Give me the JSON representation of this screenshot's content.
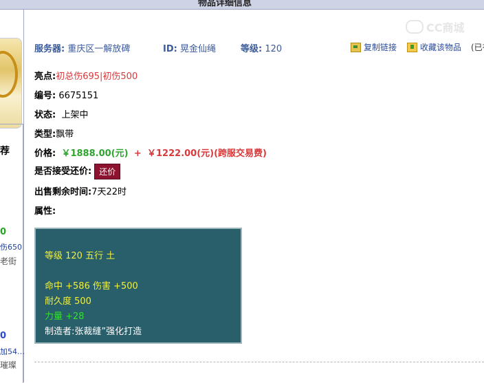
{
  "header": {
    "title": "物品详细信息"
  },
  "watermark": {
    "text": "CC商城"
  },
  "sidebar": {
    "heading": "荐",
    "items": [
      {
        "price": "0",
        "name": "伤650",
        "seller": "老街"
      },
      {
        "price": "0",
        "name": "加54…",
        "seller": "璀璨"
      }
    ]
  },
  "info": {
    "server_label": "服务器:",
    "server_value": "重庆区一解放碑",
    "id_label": "ID:",
    "id_value": "晃金仙绳",
    "level_label": "等级:",
    "level_value": "120",
    "copy_link": "复制链接",
    "favorite": "收藏该物品",
    "extra": "(已有"
  },
  "details": {
    "highlight_label": "亮点:",
    "highlight_value": "初总伤695|初伤500",
    "number_label": "编号:",
    "number_value": "6675151",
    "status_label": "状态:",
    "status_value": "上架中",
    "type_label": "类型:",
    "type_value": "飘带",
    "price_label": "价格:",
    "price_main": "￥1888.00(元)",
    "price_plus": "+",
    "price_fee": "￥1222.00(元)(跨服交易费)",
    "counter_label": "是否接受还价:",
    "counter_button": "还价",
    "remaining_label": "出售剩余时间:",
    "remaining_value": "7天22时",
    "attr_label": "属性:"
  },
  "attributes": {
    "level_line": "等级 120 五行 土",
    "stats_line": "命中 +586 伤害 +500",
    "durability_line": "耐久度 500",
    "strength_line": "力量 +28",
    "maker_line": "制造者:张裁缝”强化打造"
  },
  "colors": {
    "accent": "#3a5a9a",
    "price_red": "#d8393b",
    "price_green": "#2ea52e",
    "attr_bg": "#285f6a",
    "button_bg": "#8d1230"
  }
}
